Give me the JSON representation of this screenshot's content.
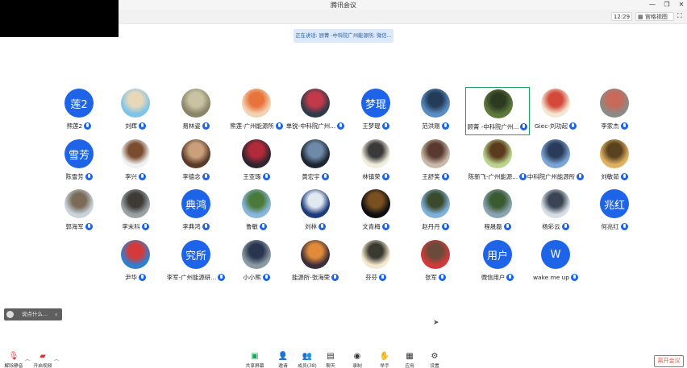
{
  "window": {
    "title": "腾讯会议",
    "controls": [
      "—",
      "❐",
      "✕"
    ]
  },
  "toolbar": {
    "clock": "12:29",
    "view_button": "宫格视图",
    "fullscreen_icon": "fullscreen-icon"
  },
  "speaking_banner": "正在讲话: 顾菁 -中科院广州能源所; 微信...",
  "participants": [
    {
      "name": "熊莲2",
      "avatar_text": "莲2",
      "avatar_kind": "text"
    },
    {
      "name": "刘辉",
      "avatar_kind": "photo",
      "colors": [
        "#7fc4e8",
        "#e8d8b8"
      ]
    },
    {
      "name": "易林姿",
      "avatar_kind": "photo",
      "colors": [
        "#8a8568",
        "#c9c3a4"
      ]
    },
    {
      "name": "熊莲-广州能源所",
      "avatar_kind": "photo",
      "colors": [
        "#f3d2b3",
        "#e8743c"
      ]
    },
    {
      "name": "单锐-中科院广州...",
      "avatar_kind": "photo",
      "colors": [
        "#2d3b4a",
        "#c23a4a"
      ]
    },
    {
      "name": "王梦琨",
      "avatar_text": "梦琨",
      "avatar_kind": "text"
    },
    {
      "name": "范洪刚",
      "avatar_kind": "photo",
      "colors": [
        "#5a8dc4",
        "#233c57"
      ]
    },
    {
      "name": "顾菁 -中科院广州...",
      "avatar_kind": "photo",
      "colors": [
        "#5e7a3a",
        "#2d3a22"
      ],
      "active": true
    },
    {
      "name": "Giec-刘功起",
      "avatar_kind": "photo",
      "colors": [
        "#f4e6d2",
        "#d44a3a"
      ]
    },
    {
      "name": "李家杰",
      "avatar_kind": "photo",
      "colors": [
        "#8c8a84",
        "#c76a5c"
      ]
    },
    {
      "name": "陈雪芳",
      "avatar_text": "雪芳",
      "avatar_kind": "text"
    },
    {
      "name": "李兴",
      "avatar_kind": "photo",
      "colors": [
        "#f0f0f0",
        "#7a4c30"
      ]
    },
    {
      "name": "李德念",
      "avatar_kind": "photo",
      "colors": [
        "#5b3a2a",
        "#c9a07a"
      ]
    },
    {
      "name": "王亚琢",
      "avatar_kind": "photo",
      "colors": [
        "#2e2430",
        "#b02a3a"
      ]
    },
    {
      "name": "黄宏宇",
      "avatar_kind": "photo",
      "colors": [
        "#1d2630",
        "#6f8aa8"
      ]
    },
    {
      "name": "林镇荣",
      "avatar_kind": "photo",
      "colors": [
        "#f2eedc",
        "#3a3a3a"
      ]
    },
    {
      "name": "王舒笑",
      "avatar_kind": "photo",
      "colors": [
        "#c8b9a8",
        "#5a3a30"
      ]
    },
    {
      "name": "陈新飞-广州能源...",
      "avatar_kind": "photo",
      "colors": [
        "#b9d48c",
        "#5c3a1e"
      ]
    },
    {
      "name": "中科院广州能源所",
      "avatar_kind": "photo",
      "colors": [
        "#7aa5d6",
        "#2a3c5a"
      ]
    },
    {
      "name": "刘敏茹",
      "avatar_kind": "photo",
      "colors": [
        "#e0b260",
        "#5a4220"
      ]
    },
    {
      "name": "郭海军",
      "avatar_kind": "photo",
      "colors": [
        "#c9d3da",
        "#7a6a58"
      ]
    },
    {
      "name": "李末科",
      "avatar_kind": "photo",
      "colors": [
        "#9aa2a6",
        "#3e3a36"
      ]
    },
    {
      "name": "李典鸿",
      "avatar_text": "典鸿",
      "avatar_kind": "text"
    },
    {
      "name": "鲁敏",
      "avatar_kind": "photo",
      "colors": [
        "#88b6de",
        "#4a7a3a"
      ]
    },
    {
      "name": "刘林",
      "avatar_kind": "photo",
      "colors": [
        "#1d3b7a",
        "#e0e8f0"
      ]
    },
    {
      "name": "文青梅",
      "avatar_kind": "photo",
      "colors": [
        "#0e0e12",
        "#7a5020"
      ]
    },
    {
      "name": "赵丹丹",
      "avatar_kind": "photo",
      "colors": [
        "#7fb0dc",
        "#3a4a2a"
      ]
    },
    {
      "name": "程晟磊",
      "avatar_kind": "photo",
      "colors": [
        "#8aa4b4",
        "#3a5a30"
      ]
    },
    {
      "name": "杨彩云",
      "avatar_kind": "photo",
      "colors": [
        "#d6dde6",
        "#3a4454"
      ]
    },
    {
      "name": "何兆红",
      "avatar_text": "兆红",
      "avatar_kind": "text"
    },
    {
      "name": "尹华",
      "avatar_kind": "photo",
      "colors": [
        "#2e7fd0",
        "#d43a3a"
      ]
    },
    {
      "name": "李军-广州能源研...",
      "avatar_text": "究所",
      "avatar_kind": "text"
    },
    {
      "name": "小小熊",
      "avatar_kind": "photo",
      "colors": [
        "#8a9aa4",
        "#2a3650"
      ]
    },
    {
      "name": "能源所-张海荣",
      "avatar_kind": "photo",
      "colors": [
        "#3a2e3a",
        "#e08a3a"
      ]
    },
    {
      "name": "芬芬",
      "avatar_kind": "photo",
      "colors": [
        "#f4e8d0",
        "#3a3a30"
      ]
    },
    {
      "name": "张军",
      "avatar_kind": "photo",
      "colors": [
        "#d23a3a",
        "#6a4a3a"
      ]
    },
    {
      "name": "微信用户",
      "avatar_text": "用户",
      "avatar_kind": "text"
    },
    {
      "name": "wake me up",
      "avatar_text": "W",
      "avatar_kind": "text"
    }
  ],
  "chat_pill": {
    "text": "说点什么..."
  },
  "bottom": {
    "left_tools": [
      {
        "label": "解除静音",
        "icon": "mic-muted-icon"
      },
      {
        "label": "开启视频",
        "icon": "camera-off-icon"
      }
    ],
    "center_tools": [
      {
        "label": "共享屏幕",
        "icon": "share-screen-icon"
      },
      {
        "label": "邀请",
        "icon": "invite-icon"
      },
      {
        "label": "成员(38)",
        "icon": "members-icon"
      },
      {
        "label": "聊天",
        "icon": "chat-icon"
      },
      {
        "label": "录制",
        "icon": "record-icon"
      },
      {
        "label": "举手",
        "icon": "raise-hand-icon"
      },
      {
        "label": "应用",
        "icon": "apps-icon"
      },
      {
        "label": "设置",
        "icon": "settings-icon"
      }
    ],
    "leave": "离开会议"
  },
  "accent_color": "#1e64e8",
  "active_border_color": "#1aa35a",
  "leave_color": "#e05b4b"
}
